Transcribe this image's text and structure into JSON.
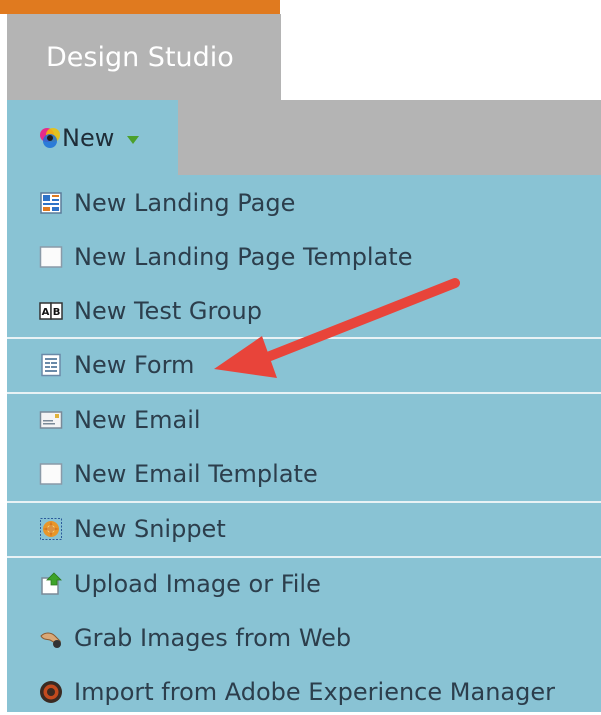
{
  "header": {
    "title": "Design Studio"
  },
  "new_button": {
    "label": "New"
  },
  "menu": {
    "items": [
      {
        "label": "New Landing Page",
        "icon": "landing-page-icon"
      },
      {
        "label": "New Landing Page Template",
        "icon": "template-icon"
      },
      {
        "label": "New Test Group",
        "icon": "test-group-icon"
      },
      {
        "label": "New Form",
        "icon": "form-icon"
      },
      {
        "label": "New Email",
        "icon": "email-icon"
      },
      {
        "label": "New Email Template",
        "icon": "template-icon"
      },
      {
        "label": "New Snippet",
        "icon": "snippet-icon"
      },
      {
        "label": "Upload Image or File",
        "icon": "upload-icon"
      },
      {
        "label": "Grab Images from Web",
        "icon": "grab-images-icon"
      },
      {
        "label": "Import from Adobe Experience Manager",
        "icon": "aem-icon"
      }
    ]
  },
  "colors": {
    "accent_bar": "#e07a1f",
    "tab_gray": "#b4b4b4",
    "menu_bg": "#89c3d4",
    "annotation_arrow": "#e8443a"
  }
}
